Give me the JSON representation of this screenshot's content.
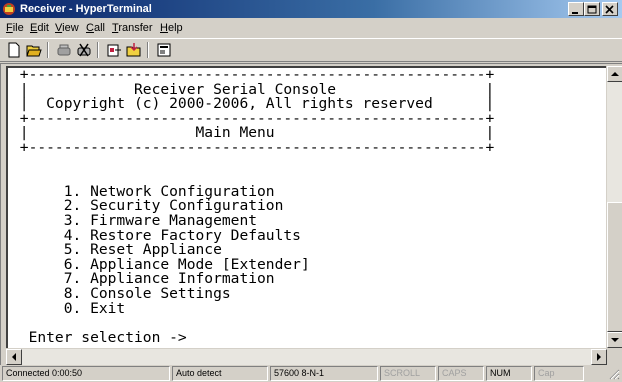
{
  "window": {
    "title": "Receiver - HyperTerminal",
    "controls": {
      "minimize": "_",
      "maximize": "□",
      "close": "X"
    }
  },
  "menu": [
    {
      "label": "File",
      "accel": "F",
      "rest": "ile"
    },
    {
      "label": "Edit",
      "accel": "E",
      "rest": "dit"
    },
    {
      "label": "View",
      "accel": "V",
      "rest": "iew"
    },
    {
      "label": "Call",
      "accel": "C",
      "rest": "all"
    },
    {
      "label": "Transfer",
      "accel": "T",
      "rest": "ransfer"
    },
    {
      "label": "Help",
      "accel": "H",
      "rest": "elp"
    }
  ],
  "toolbar": {
    "buttons": [
      "new-icon",
      "open-icon",
      "disconnect-icon",
      "call-icon",
      "send-icon",
      "receive-icon",
      "properties-icon"
    ]
  },
  "terminal": {
    "lines": [
      " +----------------------------------------------------+",
      " |            Receiver Serial Console                 |",
      " |  Copyright (c) 2000-2006, All rights reserved      |",
      " +----------------------------------------------------+",
      " |                   Main Menu                        |",
      " +----------------------------------------------------+",
      "",
      "",
      "      1. Network Configuration",
      "      2. Security Configuration",
      "      3. Firmware Management",
      "      4. Restore Factory Defaults",
      "      5. Reset Appliance",
      "      6. Appliance Mode [Extender]",
      "      7. Appliance Information",
      "      8. Console Settings",
      "      0. Exit",
      "",
      "  Enter selection ->"
    ]
  },
  "status": {
    "connected": "Connected 0:00:50",
    "detect": "Auto detect",
    "port": "57600 8-N-1",
    "scroll": "SCROLL",
    "caps": "CAPS",
    "num": "NUM",
    "cap": "Cap"
  }
}
